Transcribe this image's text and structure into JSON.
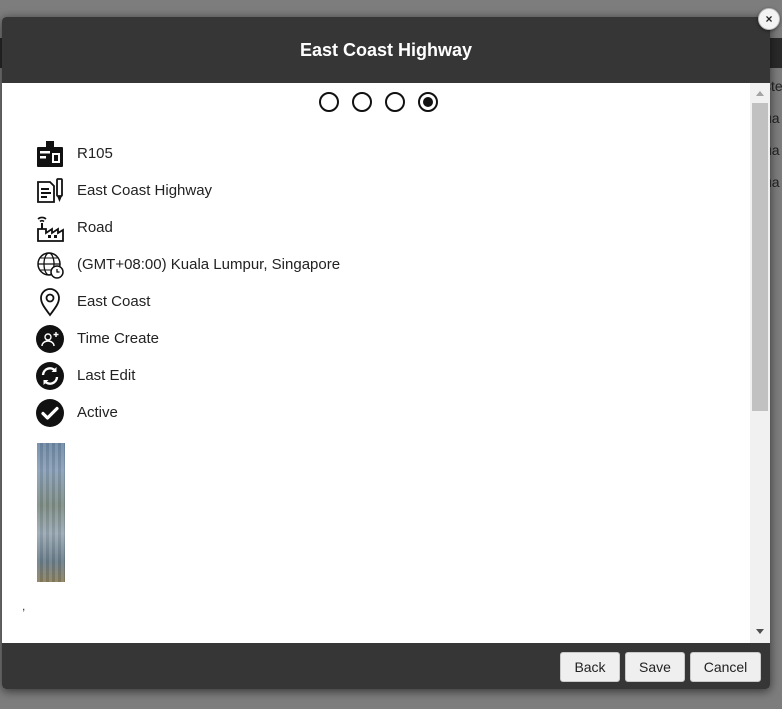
{
  "dialog": {
    "title": "East Coast Highway",
    "close_label": "×"
  },
  "background": {
    "peek_texts": [
      "ste",
      "ua",
      "ua",
      "ua"
    ]
  },
  "stepper": {
    "steps": [
      {
        "active": false
      },
      {
        "active": false
      },
      {
        "active": false
      },
      {
        "active": true
      }
    ]
  },
  "details": [
    {
      "icon": "id-badge-icon",
      "text": "R105"
    },
    {
      "icon": "document-pen-icon",
      "text": "East Coast Highway"
    },
    {
      "icon": "factory-signal-icon",
      "text": "Road"
    },
    {
      "icon": "globe-clock-icon",
      "text": "(GMT+08:00) Kuala Lumpur, Singapore"
    },
    {
      "icon": "map-pin-icon",
      "text": "East Coast"
    },
    {
      "icon": "user-add-icon",
      "text": "Time Create"
    },
    {
      "icon": "refresh-icon",
      "text": "Last Edit"
    },
    {
      "icon": "check-circle-icon",
      "text": "Active"
    }
  ],
  "extra": {
    "comma1": ",",
    "comma2": ","
  },
  "footer": {
    "back_label": "Back",
    "save_label": "Save",
    "cancel_label": "Cancel"
  }
}
